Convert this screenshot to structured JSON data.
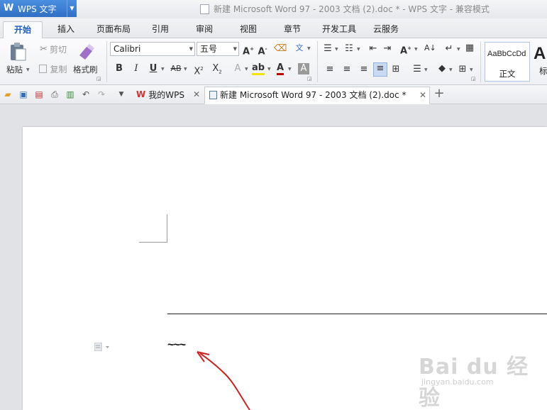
{
  "app": {
    "logo": "W",
    "name": "WPS 文字",
    "window_title": "新建 Microsoft Word 97 - 2003 文档 (2).doc * - WPS 文字 - 兼容模式"
  },
  "ribbon_tabs": [
    "开始",
    "插入",
    "页面布局",
    "引用",
    "审阅",
    "视图",
    "章节",
    "开发工具",
    "云服务"
  ],
  "clipboard": {
    "paste": "粘贴",
    "cut": "剪切",
    "copy": "复制",
    "format_painter": "格式刷"
  },
  "font": {
    "name": "Calibri",
    "size": "五号"
  },
  "styles": {
    "normal_sample": "AaBbCcDd",
    "normal_label": "正文",
    "next_sample": "A",
    "next_label": "标"
  },
  "doc_tabs": {
    "my_wps": "我的WPS",
    "document": "新建 Microsoft Word 97 - 2003 文档 (2).doc *"
  },
  "document": {
    "text": "~~~"
  },
  "watermark": {
    "main": "Bai du 经验",
    "sub": "jingyan.baidu.com"
  },
  "colors": {
    "accent": "#2f6fc4",
    "annotation": "#cc2222",
    "font_color": "#c00000"
  }
}
